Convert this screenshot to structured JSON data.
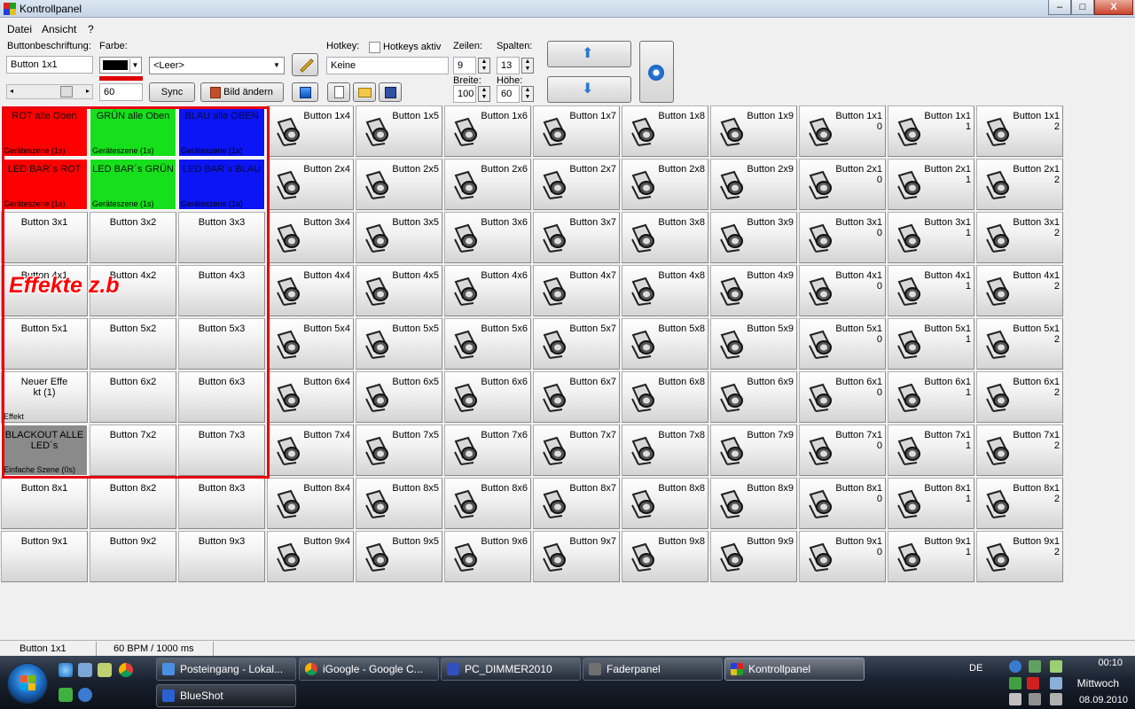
{
  "window": {
    "title": "Kontrollpanel",
    "minimize": "‒",
    "maximize": "□",
    "close": "X"
  },
  "menu": [
    "Datei",
    "Ansicht",
    "?"
  ],
  "toolbar": {
    "caption_label": "Buttonbeschriftung:",
    "caption_value": "Button 1x1",
    "color_label": "Farbe:",
    "color_value": "#000000",
    "underline_color": "#e00000",
    "number_value": "60",
    "scene_select": "<Leer>",
    "sync_label": "Sync",
    "change_image_label": "Bild ändern",
    "hotkey_label": "Hotkey:",
    "hotkey_value": "Keine",
    "hotkeys_active_label": "Hotkeys aktiv",
    "rows_label": "Zeilen:",
    "rows_value": "9",
    "cols_label": "Spalten:",
    "cols_value": "13",
    "width_label": "Breite:",
    "width_value": "100",
    "height_label": "Höhe:",
    "height_value": "60"
  },
  "colors": {
    "red": "#ff0000",
    "green": "#16e01b",
    "blue": "#0b15f5",
    "gray": "#8a8a8a",
    "annotation": "#e8000f"
  },
  "grid": {
    "rows": [
      [
        {
          "label": "ROT alle Oben",
          "sub": "Geräteszene (1s)",
          "color": "red"
        },
        {
          "label": "GRÜN alle Oben",
          "sub": "Geräteszene (1s)",
          "color": "green"
        },
        {
          "label": "BLAU alle OBEN",
          "sub": "Geräteszene (1s)",
          "color": "blue"
        },
        {
          "label": "Button 1x4",
          "icon": true
        },
        {
          "label": "Button 1x5",
          "icon": true
        },
        {
          "label": "Button 1x6",
          "icon": true
        },
        {
          "label": "Button 1x7",
          "icon": true
        },
        {
          "label": "Button 1x8",
          "icon": true
        },
        {
          "label": "Button 1x9",
          "icon": true
        },
        {
          "label": "Button 1x1\n0",
          "icon": true
        },
        {
          "label": "Button 1x1\n1",
          "icon": true
        },
        {
          "label": "Button 1x1\n2",
          "icon": true
        }
      ],
      [
        {
          "label": "LED BAR´s ROT",
          "sub": "Geräteszene (1s)",
          "color": "red"
        },
        {
          "label": "LED BAR´s GRÜN",
          "sub": "Geräteszene (1s)",
          "color": "green"
        },
        {
          "label": "LED BAR´s BLAU",
          "sub": "Geräteszene (1s)",
          "color": "blue"
        },
        {
          "label": "Button 2x4",
          "icon": true
        },
        {
          "label": "Button 2x5",
          "icon": true
        },
        {
          "label": "Button 2x6",
          "icon": true
        },
        {
          "label": "Button 2x7",
          "icon": true
        },
        {
          "label": "Button 2x8",
          "icon": true
        },
        {
          "label": "Button 2x9",
          "icon": true
        },
        {
          "label": "Button 2x1\n0",
          "icon": true
        },
        {
          "label": "Button 2x1\n1",
          "icon": true
        },
        {
          "label": "Button 2x1\n2",
          "icon": true
        }
      ],
      [
        {
          "label": "Button 3x1"
        },
        {
          "label": "Button 3x2"
        },
        {
          "label": "Button 3x3"
        },
        {
          "label": "Button 3x4",
          "icon": true
        },
        {
          "label": "Button 3x5",
          "icon": true
        },
        {
          "label": "Button 3x6",
          "icon": true
        },
        {
          "label": "Button 3x7",
          "icon": true
        },
        {
          "label": "Button 3x8",
          "icon": true
        },
        {
          "label": "Button 3x9",
          "icon": true
        },
        {
          "label": "Button 3x1\n0",
          "icon": true
        },
        {
          "label": "Button 3x1\n1",
          "icon": true
        },
        {
          "label": "Button 3x1\n2",
          "icon": true
        }
      ],
      [
        {
          "label": "Button 4x1"
        },
        {
          "label": "Button 4x2"
        },
        {
          "label": "Button 4x3"
        },
        {
          "label": "Button 4x4",
          "icon": true
        },
        {
          "label": "Button 4x5",
          "icon": true
        },
        {
          "label": "Button 4x6",
          "icon": true
        },
        {
          "label": "Button 4x7",
          "icon": true
        },
        {
          "label": "Button 4x8",
          "icon": true
        },
        {
          "label": "Button 4x9",
          "icon": true
        },
        {
          "label": "Button 4x1\n0",
          "icon": true
        },
        {
          "label": "Button 4x1\n1",
          "icon": true
        },
        {
          "label": "Button 4x1\n2",
          "icon": true
        }
      ],
      [
        {
          "label": "Button 5x1"
        },
        {
          "label": "Button 5x2"
        },
        {
          "label": "Button 5x3"
        },
        {
          "label": "Button 5x4",
          "icon": true
        },
        {
          "label": "Button 5x5",
          "icon": true
        },
        {
          "label": "Button 5x6",
          "icon": true
        },
        {
          "label": "Button 5x7",
          "icon": true
        },
        {
          "label": "Button 5x8",
          "icon": true
        },
        {
          "label": "Button 5x9",
          "icon": true
        },
        {
          "label": "Button 5x1\n0",
          "icon": true
        },
        {
          "label": "Button 5x1\n1",
          "icon": true
        },
        {
          "label": "Button 5x1\n2",
          "icon": true
        }
      ],
      [
        {
          "label": "Neuer Effe\nkt (1)",
          "sub": "Effekt"
        },
        {
          "label": "Button 6x2"
        },
        {
          "label": "Button 6x3"
        },
        {
          "label": "Button 6x4",
          "icon": true
        },
        {
          "label": "Button 6x5",
          "icon": true
        },
        {
          "label": "Button 6x6",
          "icon": true
        },
        {
          "label": "Button 6x7",
          "icon": true
        },
        {
          "label": "Button 6x8",
          "icon": true
        },
        {
          "label": "Button 6x9",
          "icon": true
        },
        {
          "label": "Button 6x1\n0",
          "icon": true
        },
        {
          "label": "Button 6x1\n1",
          "icon": true
        },
        {
          "label": "Button 6x1\n2",
          "icon": true
        }
      ],
      [
        {
          "label": "BLACKOUT ALLE LED´s",
          "sub": "Einfache Szene (0s)",
          "color": "gray"
        },
        {
          "label": "Button 7x2"
        },
        {
          "label": "Button 7x3"
        },
        {
          "label": "Button 7x4",
          "icon": true
        },
        {
          "label": "Button 7x5",
          "icon": true
        },
        {
          "label": "Button 7x6",
          "icon": true
        },
        {
          "label": "Button 7x7",
          "icon": true
        },
        {
          "label": "Button 7x8",
          "icon": true
        },
        {
          "label": "Button 7x9",
          "icon": true
        },
        {
          "label": "Button 7x1\n0",
          "icon": true
        },
        {
          "label": "Button 7x1\n1",
          "icon": true
        },
        {
          "label": "Button 7x1\n2",
          "icon": true
        }
      ],
      [
        {
          "label": "Button 8x1"
        },
        {
          "label": "Button 8x2"
        },
        {
          "label": "Button 8x3"
        },
        {
          "label": "Button 8x4",
          "icon": true
        },
        {
          "label": "Button 8x5",
          "icon": true
        },
        {
          "label": "Button 8x6",
          "icon": true
        },
        {
          "label": "Button 8x7",
          "icon": true
        },
        {
          "label": "Button 8x8",
          "icon": true
        },
        {
          "label": "Button 8x9",
          "icon": true
        },
        {
          "label": "Button 8x1\n0",
          "icon": true
        },
        {
          "label": "Button 8x1\n1",
          "icon": true
        },
        {
          "label": "Button 8x1\n2",
          "icon": true
        }
      ],
      [
        {
          "label": "Button 9x1"
        },
        {
          "label": "Button 9x2"
        },
        {
          "label": "Button 9x3"
        },
        {
          "label": "Button 9x4",
          "icon": true
        },
        {
          "label": "Button 9x5",
          "icon": true
        },
        {
          "label": "Button 9x6",
          "icon": true
        },
        {
          "label": "Button 9x7",
          "icon": true
        },
        {
          "label": "Button 9x8",
          "icon": true
        },
        {
          "label": "Button 9x9",
          "icon": true
        },
        {
          "label": "Button 9x1\n0",
          "icon": true
        },
        {
          "label": "Button 9x1\n1",
          "icon": true
        },
        {
          "label": "Button 9x1\n2",
          "icon": true
        }
      ]
    ]
  },
  "annotation": {
    "text": "Effekte z.b"
  },
  "status": {
    "selected": "Button 1x1",
    "bpm": "60 BPM / 1000 ms"
  },
  "taskbar": {
    "tasks_row1": [
      "Posteingang - Lokal...",
      "iGoogle - Google C...",
      "PC_DIMMER2010",
      "Faderpanel",
      "Kontrollpanel"
    ],
    "tasks_row2": [
      "BlueShot"
    ],
    "lang": "DE",
    "time": "00:10",
    "day": "Mittwoch",
    "date": "08.09.2010"
  }
}
